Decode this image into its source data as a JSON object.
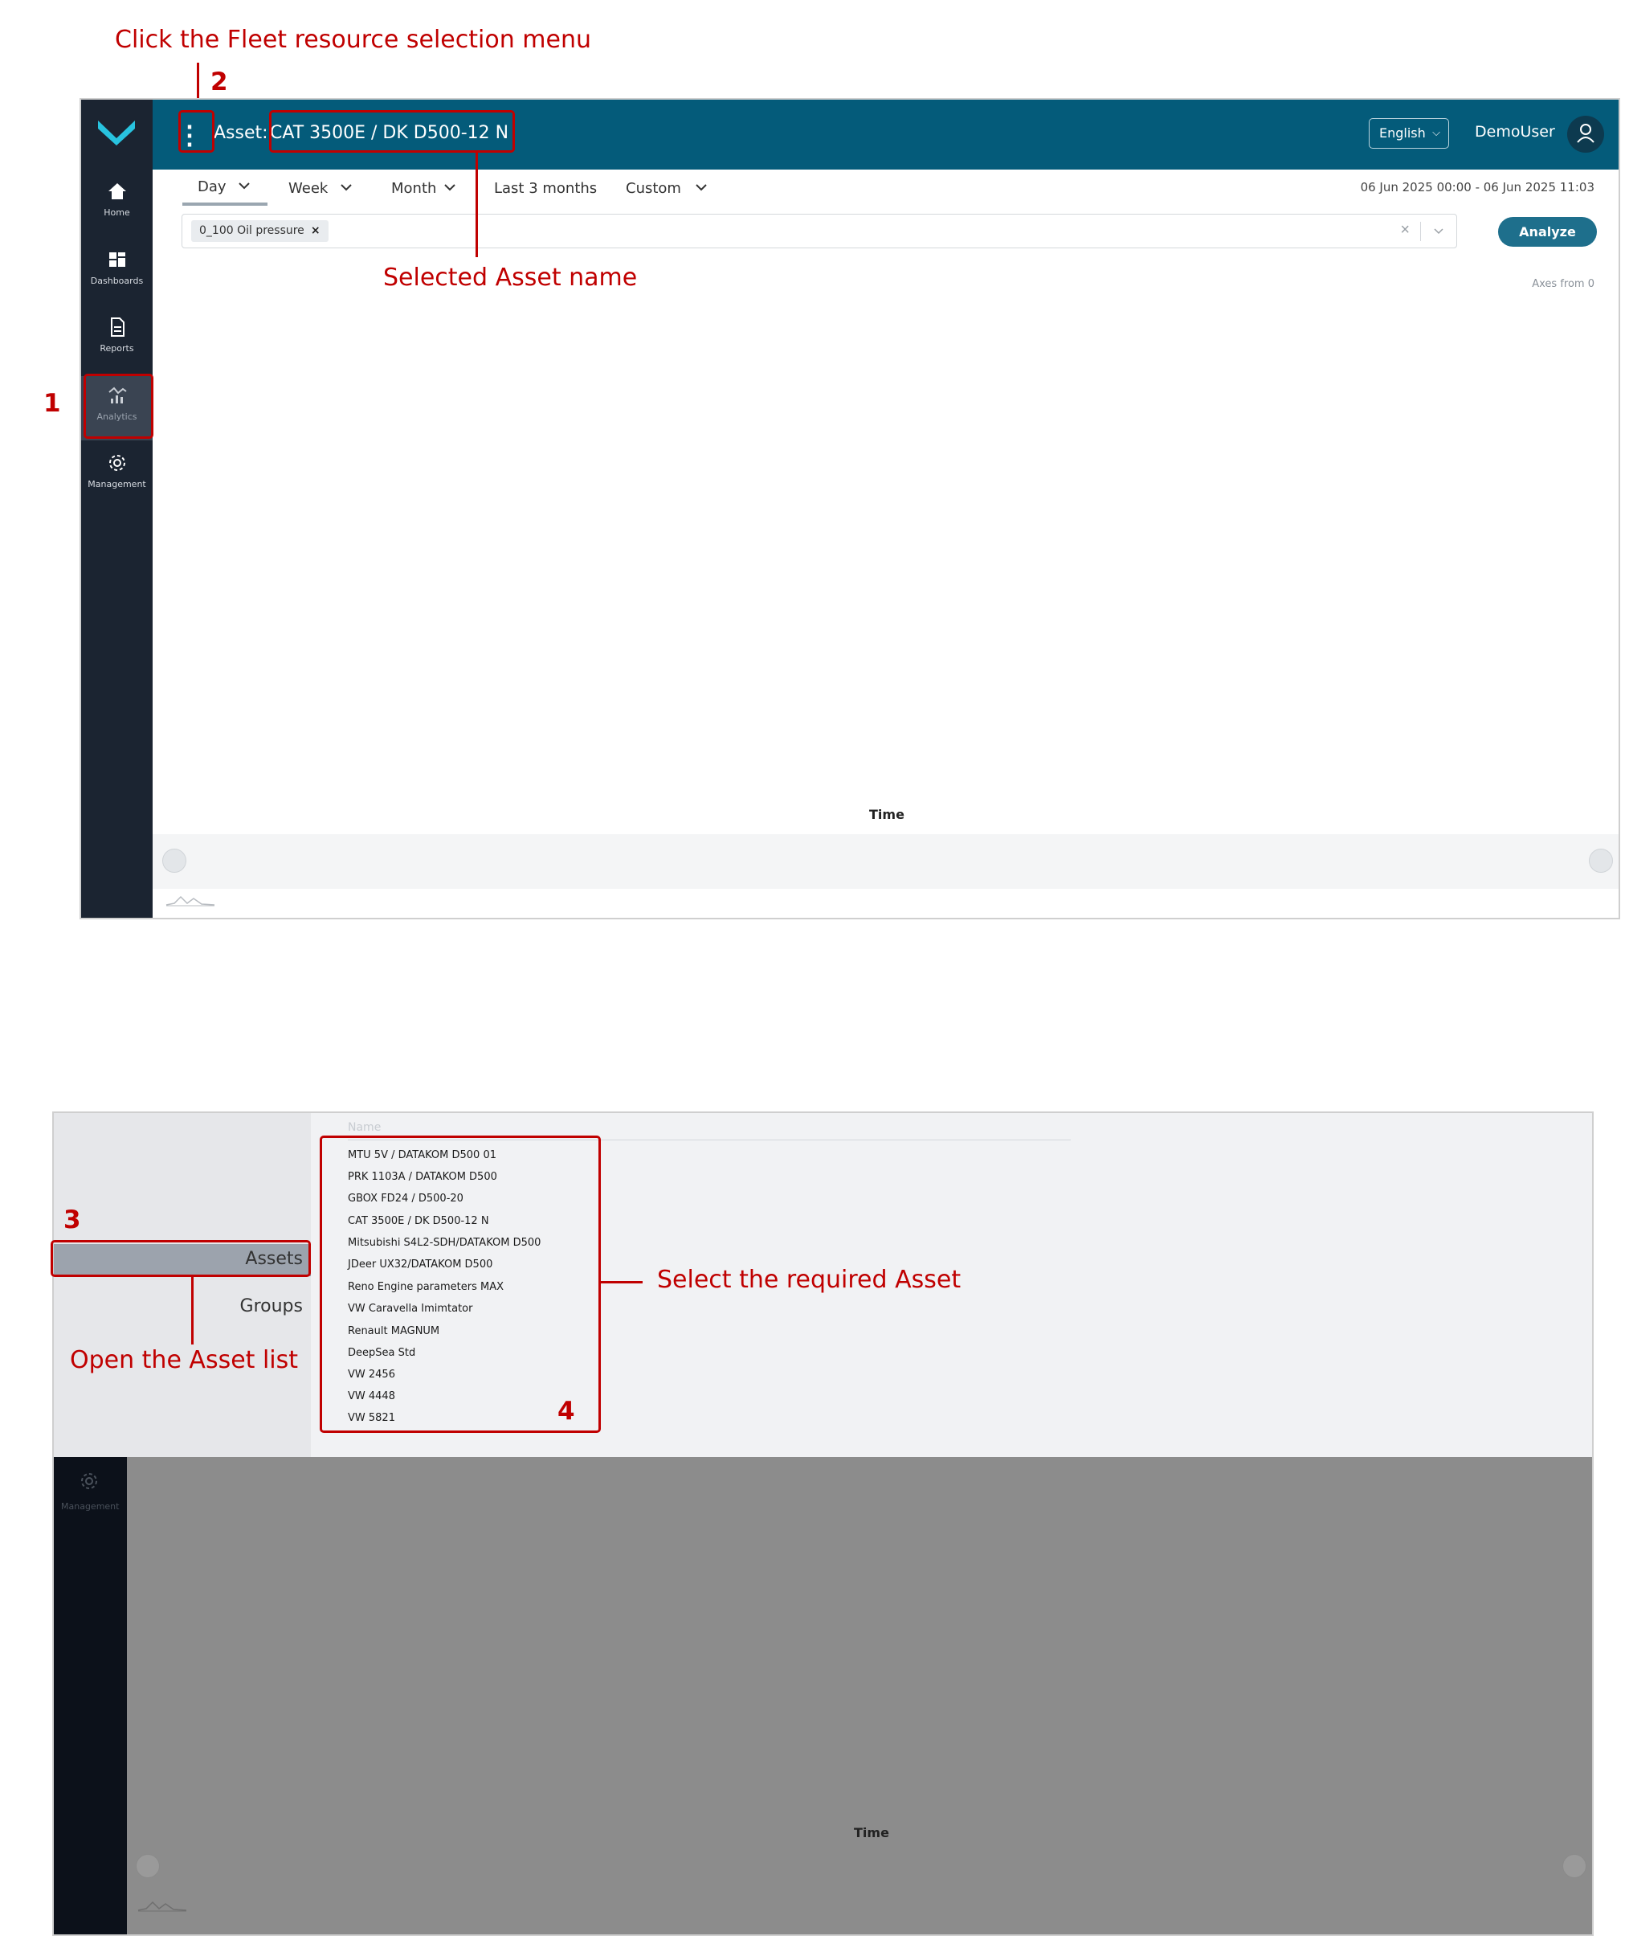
{
  "annotations": {
    "step1_number": "1",
    "step2_number": "2",
    "step2_text": "Click the Fleet resource selection menu",
    "asset_name_callout": "Selected Asset name",
    "step3_number": "3",
    "step3_text": "Open the Asset list",
    "step4_number": "4",
    "step4_text": "Select the required Asset"
  },
  "app": {
    "sidebar": {
      "items": [
        {
          "label": "Home",
          "icon": "home-icon"
        },
        {
          "label": "Dashboards",
          "icon": "dashboard-icon"
        },
        {
          "label": "Reports",
          "icon": "report-icon"
        },
        {
          "label": "Analytics",
          "icon": "analytics-icon",
          "active": true
        },
        {
          "label": "Management",
          "icon": "gear-icon"
        }
      ]
    },
    "header": {
      "asset_prefix": "Asset:",
      "asset_name": "CAT 3500E / DK D500-12 N",
      "language": "English",
      "user": "DemoUser"
    },
    "tabs": [
      {
        "label": "Day",
        "has_chevron": true,
        "active": true
      },
      {
        "label": "Week",
        "has_chevron": true
      },
      {
        "label": "Month",
        "has_chevron": true
      },
      {
        "label": "Last 3 months",
        "has_chevron": false
      },
      {
        "label": "Custom",
        "has_chevron": true
      }
    ],
    "date_range": "06 Jun 2025 00:00 - 06 Jun 2025 11:03",
    "filter_chip": "0_100 Oil pressure",
    "analyze_label": "Analyze",
    "axes_note": "Axes from 0",
    "x_axis_label": "Time"
  },
  "asset_menu": {
    "categories": [
      "Assets",
      "Groups"
    ],
    "list_header": "Name",
    "assets": [
      "MTU 5V / DATAKOM D500 01",
      "PRK 1103A / DATAKOM D500",
      "GBOX FD24 / D500-20",
      "CAT 3500E / DK D500-12 N",
      "Mitsubishi S4L2-SDH/DATAKOM D500",
      "JDeer UX32/DATAKOM D500",
      "Reno Engine parameters MAX",
      "VW Caravella Imimtator",
      "Renault MAGNUM",
      "DeepSea Std",
      "VW 2456",
      "VW 4448",
      "VW 5821"
    ],
    "dim_sidebar_label": "Management",
    "dim_x_axis_label": "Time"
  },
  "colors": {
    "annotation": "#c00000",
    "header_bg": "#045b7a",
    "sidebar_bg": "#1b2431",
    "accent_logo": "#28c3df",
    "analyze_bg": "#1e6f8c"
  }
}
